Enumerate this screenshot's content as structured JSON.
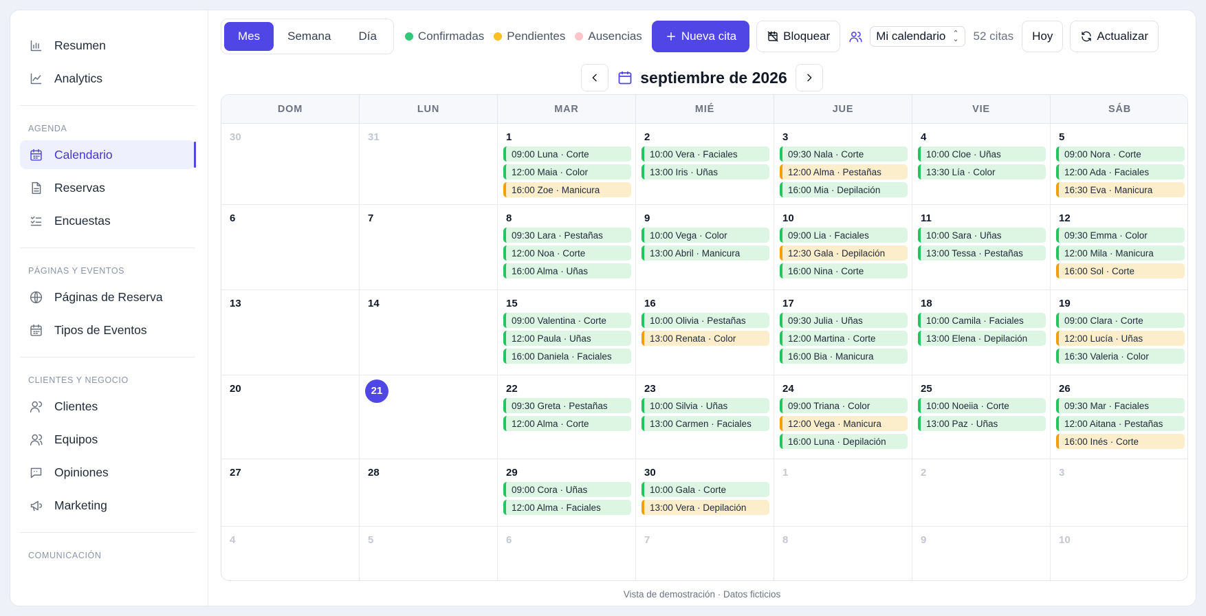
{
  "sidebar": {
    "top_items": [
      {
        "label": "Resumen",
        "icon": "bar-chart-icon"
      },
      {
        "label": "Analytics",
        "icon": "line-chart-icon"
      }
    ],
    "sections": [
      {
        "title": "AGENDA",
        "items": [
          {
            "label": "Calendario",
            "icon": "calendar-icon",
            "active": true
          },
          {
            "label": "Reservas",
            "icon": "document-icon"
          },
          {
            "label": "Encuestas",
            "icon": "checklist-icon"
          }
        ]
      },
      {
        "title": "PÁGINAS Y EVENTOS",
        "items": [
          {
            "label": "Páginas de Reserva",
            "icon": "globe-icon"
          },
          {
            "label": "Tipos de Eventos",
            "icon": "calendar-icon"
          }
        ]
      },
      {
        "title": "CLIENTES Y NEGOCIO",
        "items": [
          {
            "label": "Clientes",
            "icon": "user-icon"
          },
          {
            "label": "Equipos",
            "icon": "users-icon"
          },
          {
            "label": "Opiniones",
            "icon": "chat-icon"
          },
          {
            "label": "Marketing",
            "icon": "megaphone-icon"
          }
        ]
      },
      {
        "title": "COMUNICACIÓN",
        "items": []
      }
    ]
  },
  "toolbar": {
    "views": [
      {
        "label": "Mes",
        "active": true
      },
      {
        "label": "Semana"
      },
      {
        "label": "Día"
      }
    ],
    "legend": [
      {
        "label": "Confirmadas",
        "color": "#34c77b"
      },
      {
        "label": "Pendientes",
        "color": "#fbbf24"
      },
      {
        "label": "Ausencias",
        "color": "#fbc4c9"
      }
    ],
    "new_label": "Nueva cita",
    "block_label": "Bloquear",
    "calendar_select": "Mi calendario",
    "count": "52 citas",
    "today_label": "Hoy",
    "refresh_label": "Actualizar"
  },
  "month_title": "septiembre de 2026",
  "weekdays": [
    "DOM",
    "LUN",
    "MAR",
    "MIÉ",
    "JUE",
    "VIE",
    "SÁB"
  ],
  "weeks": [
    [
      {
        "d": "30",
        "m": true
      },
      {
        "d": "31",
        "m": true
      },
      {
        "d": "1",
        "ev": [
          [
            "09:00 Luna · Corte",
            "c"
          ],
          [
            "12:00 Maia · Color",
            "c"
          ],
          [
            "16:00 Zoe · Manicura",
            "p"
          ]
        ]
      },
      {
        "d": "2",
        "ev": [
          [
            "10:00 Vera · Faciales",
            "c"
          ],
          [
            "13:00 Iris · Uñas",
            "c"
          ]
        ]
      },
      {
        "d": "3",
        "ev": [
          [
            "09:30 Nala · Corte",
            "c"
          ],
          [
            "12:00 Alma · Pestañas",
            "p"
          ],
          [
            "16:00 Mia · Depilación",
            "c"
          ]
        ]
      },
      {
        "d": "4",
        "ev": [
          [
            "10:00 Cloe · Uñas",
            "c"
          ],
          [
            "13:30 Lía · Color",
            "c"
          ]
        ]
      },
      {
        "d": "5",
        "ev": [
          [
            "09:00 Nora · Corte",
            "c"
          ],
          [
            "12:00 Ada · Faciales",
            "c"
          ],
          [
            "16:30 Eva · Manicura",
            "p"
          ]
        ]
      }
    ],
    [
      {
        "d": "6"
      },
      {
        "d": "7"
      },
      {
        "d": "8",
        "ev": [
          [
            "09:30 Lara · Pestañas",
            "c"
          ],
          [
            "12:00 Noa · Corte",
            "c"
          ],
          [
            "16:00 Alma · Uñas",
            "c"
          ]
        ]
      },
      {
        "d": "9",
        "ev": [
          [
            "10:00 Vega · Color",
            "c"
          ],
          [
            "13:00 Abril · Manicura",
            "c"
          ]
        ]
      },
      {
        "d": "10",
        "ev": [
          [
            "09:00 Lia · Faciales",
            "c"
          ],
          [
            "12:30 Gala · Depilación",
            "p"
          ],
          [
            "16:00 Nina · Corte",
            "c"
          ]
        ]
      },
      {
        "d": "11",
        "ev": [
          [
            "10:00 Sara · Uñas",
            "c"
          ],
          [
            "13:00 Tessa · Pestañas",
            "c"
          ]
        ]
      },
      {
        "d": "12",
        "ev": [
          [
            "09:30 Emma · Color",
            "c"
          ],
          [
            "12:00 Mila · Manicura",
            "c"
          ],
          [
            "16:00 Sol · Corte",
            "p"
          ]
        ]
      }
    ],
    [
      {
        "d": "13"
      },
      {
        "d": "14"
      },
      {
        "d": "15",
        "ev": [
          [
            "09:00 Valentina · Corte",
            "c"
          ],
          [
            "12:00 Paula · Uñas",
            "c"
          ],
          [
            "16:00 Daniela · Faciales",
            "c"
          ]
        ]
      },
      {
        "d": "16",
        "ev": [
          [
            "10:00 Olivia · Pestañas",
            "c"
          ],
          [
            "13:00 Renata · Color",
            "p"
          ]
        ]
      },
      {
        "d": "17",
        "ev": [
          [
            "09:30 Julia · Uñas",
            "c"
          ],
          [
            "12:00 Martina · Corte",
            "c"
          ],
          [
            "16:00 Bia · Manicura",
            "c"
          ]
        ]
      },
      {
        "d": "18",
        "ev": [
          [
            "10:00 Camila · Faciales",
            "c"
          ],
          [
            "13:00 Elena · Depilación",
            "c"
          ]
        ]
      },
      {
        "d": "19",
        "ev": [
          [
            "09:00 Clara · Corte",
            "c"
          ],
          [
            "12:00 Lucía · Uñas",
            "p"
          ],
          [
            "16:30 Valeria · Color",
            "c"
          ]
        ]
      }
    ],
    [
      {
        "d": "20"
      },
      {
        "d": "21",
        "today": true
      },
      {
        "d": "22",
        "ev": [
          [
            "09:30 Greta · Pestañas",
            "c"
          ],
          [
            "12:00 Alma · Corte",
            "c"
          ]
        ]
      },
      {
        "d": "23",
        "ev": [
          [
            "10:00 Silvia · Uñas",
            "c"
          ],
          [
            "13:00 Carmen · Faciales",
            "c"
          ]
        ]
      },
      {
        "d": "24",
        "ev": [
          [
            "09:00 Triana · Color",
            "c"
          ],
          [
            "12:00 Vega · Manicura",
            "p"
          ],
          [
            "16:00 Luna · Depilación",
            "c"
          ]
        ]
      },
      {
        "d": "25",
        "ev": [
          [
            "10:00 Noeiia · Corte",
            "c"
          ],
          [
            "13:00 Paz · Uñas",
            "c"
          ]
        ]
      },
      {
        "d": "26",
        "ev": [
          [
            "09:30 Mar · Faciales",
            "c"
          ],
          [
            "12:00 Aitana · Pestañas",
            "c"
          ],
          [
            "16:00 Inés · Corte",
            "p"
          ]
        ]
      }
    ],
    [
      {
        "d": "27"
      },
      {
        "d": "28"
      },
      {
        "d": "29",
        "ev": [
          [
            "09:00 Cora · Uñas",
            "c"
          ],
          [
            "12:00 Alma · Faciales",
            "c"
          ]
        ]
      },
      {
        "d": "30",
        "ev": [
          [
            "10:00 Gala · Corte",
            "c"
          ],
          [
            "13:00 Vera · Depilación",
            "p"
          ]
        ]
      },
      {
        "d": "1",
        "m": true
      },
      {
        "d": "2",
        "m": true
      },
      {
        "d": "3",
        "m": true
      }
    ],
    [
      {
        "d": "4",
        "m": true
      },
      {
        "d": "5",
        "m": true
      },
      {
        "d": "6",
        "m": true
      },
      {
        "d": "7",
        "m": true
      },
      {
        "d": "8",
        "m": true
      },
      {
        "d": "9",
        "m": true
      },
      {
        "d": "10",
        "m": true
      }
    ]
  ],
  "footer": "Vista de demostración · Datos ficticios"
}
